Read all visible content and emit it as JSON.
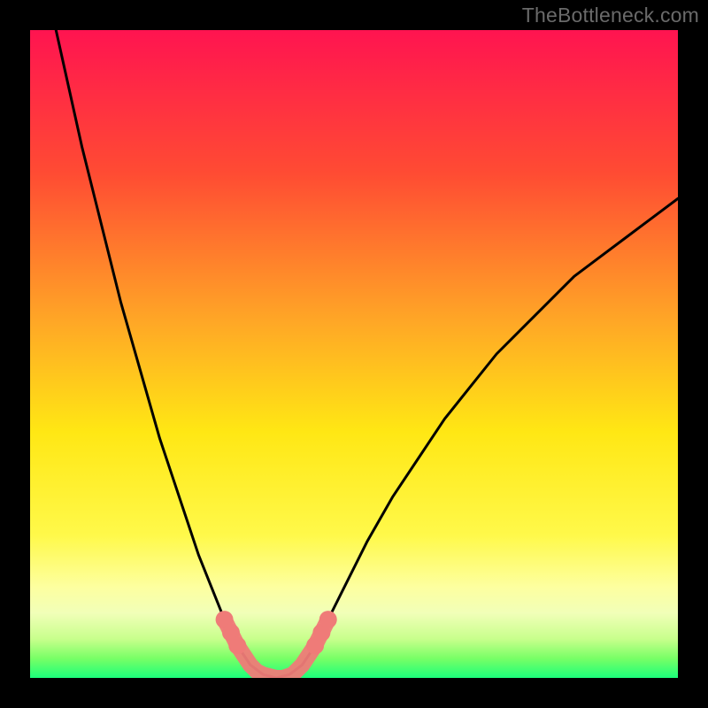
{
  "watermark": "TheBottleneck.com",
  "chart_data": {
    "type": "line",
    "title": "",
    "xlabel": "",
    "ylabel": "",
    "xlim": [
      0,
      100
    ],
    "ylim": [
      0,
      100
    ],
    "gradient_stops": [
      {
        "offset": 0,
        "color": "#ff1450"
      },
      {
        "offset": 0.22,
        "color": "#ff4b33"
      },
      {
        "offset": 0.45,
        "color": "#ffa726"
      },
      {
        "offset": 0.62,
        "color": "#ffe714"
      },
      {
        "offset": 0.78,
        "color": "#fff94a"
      },
      {
        "offset": 0.86,
        "color": "#fdffa0"
      },
      {
        "offset": 0.9,
        "color": "#f1ffb8"
      },
      {
        "offset": 0.94,
        "color": "#c8ff8c"
      },
      {
        "offset": 0.97,
        "color": "#78ff66"
      },
      {
        "offset": 1.0,
        "color": "#1cff7a"
      }
    ],
    "series": [
      {
        "name": "bottleneck-curve",
        "x": [
          4,
          6,
          8,
          10,
          12,
          14,
          16,
          18,
          20,
          22,
          24,
          26,
          28,
          30,
          32,
          34,
          36,
          38,
          40,
          42,
          44,
          46,
          48,
          52,
          56,
          60,
          64,
          68,
          72,
          76,
          80,
          84,
          88,
          92,
          96,
          100
        ],
        "y": [
          100,
          91,
          82,
          74,
          66,
          58,
          51,
          44,
          37,
          31,
          25,
          19,
          14,
          9,
          5,
          2,
          0.5,
          0,
          0.5,
          2,
          5,
          9,
          13,
          21,
          28,
          34,
          40,
          45,
          50,
          54,
          58,
          62,
          65,
          68,
          71,
          74
        ]
      }
    ],
    "markers": {
      "name": "highlighted-points",
      "color": "#ef7b78",
      "points": [
        {
          "x": 30,
          "y": 9
        },
        {
          "x": 31,
          "y": 7
        },
        {
          "x": 32,
          "y": 5
        },
        {
          "x": 34,
          "y": 2
        },
        {
          "x": 35,
          "y": 1
        },
        {
          "x": 36,
          "y": 0.5
        },
        {
          "x": 38,
          "y": 0
        },
        {
          "x": 39,
          "y": 0
        },
        {
          "x": 40.5,
          "y": 0.5
        },
        {
          "x": 42,
          "y": 2
        },
        {
          "x": 44,
          "y": 5
        },
        {
          "x": 45,
          "y": 7
        },
        {
          "x": 46,
          "y": 9
        }
      ]
    }
  }
}
